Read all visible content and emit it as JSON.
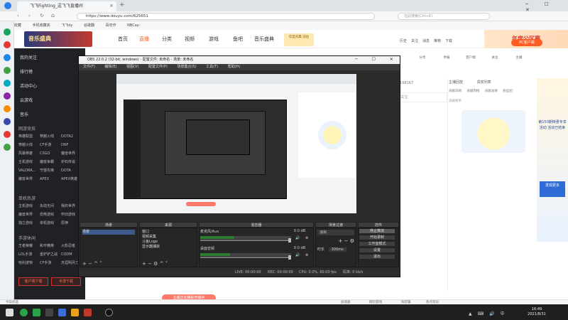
{
  "browser": {
    "tab_title": "飞飞Fighting_逗飞飞直播间",
    "url": "https://www.douyu.com/625651",
    "search_placeholder": "在此搜索(Ctrl+E)",
    "bookmarks": [
      "收藏",
      "手机收藏夹",
      "飞飞dy",
      "谷歌翻",
      "百年作",
      "NBCay-"
    ]
  },
  "douyu": {
    "logo": "音乐盛典",
    "nav": {
      "home": "首页",
      "live": "直播",
      "category": "分类",
      "video": "视频",
      "game": "游戏",
      "fishbar": "鱼吧",
      "music": "音乐盛典"
    },
    "promo": "年度庆典 前往",
    "header_icons": [
      "历史",
      "关注",
      "消息",
      "推荐",
      "下载"
    ],
    "banner_right": "年度公区赛",
    "pc_client": "PC客户端",
    "big_icons": [
      "分享",
      "举报",
      "客户端",
      "关注",
      "主播"
    ],
    "sidebar": {
      "my_follow": "我的关注",
      "ranking": "排行榜",
      "events": "活动中心",
      "cloud_game": "云游戏",
      "music": "音乐",
      "section_online": "网游竞技",
      "online_games": [
        "英雄联盟",
        "穿越火线",
        "DOTA2",
        "穿越火线",
        "CF手游",
        "DNF",
        "风暴英雄",
        "CSGO",
        "魔兽世界",
        "主机游戏",
        "魔兽争霸",
        "炉石传说",
        "VALORA...",
        "守望先锋",
        "DOTA",
        "魔兽世界",
        "APEX",
        "APEX英雄"
      ],
      "section_single": "单机热游",
      "single_games": [
        "主机游戏",
        "永劫无间",
        "我的世界",
        "魔兽世界",
        "恐怖游戏",
        "怀旧游戏",
        "独立游戏",
        "单机游戏",
        "原神"
      ],
      "section_mobile": "手游休闲",
      "mobile_games": [
        "王者荣耀",
        "和平精英",
        "火影忍者",
        "LOL手游",
        "金铲铲之战",
        "CODM",
        "哈利波特",
        "CF手游",
        "天涯明月刀"
      ],
      "download_btn": "客户端下载",
      "download_btn2": "手游下载"
    },
    "right_panel": {
      "tabs": [
        "主播回放",
        "贵宾列表"
      ],
      "sub_tabs": [
        "贡献日榜",
        "贡献周榜",
        "贡献总榜",
        "粉丝团"
      ],
      "hint": "贡献榜单",
      "floor": "2168167",
      "follow": "关注",
      "ad_text": "第150期特惠专享活动 活动已结束",
      "ad_blue": "发现更多"
    },
    "pill": "主播正在精彩开播中"
  },
  "obs": {
    "title": "OBS 22.0.2 (32-bit, windows) - 配置文件: 未命名 - 场景: 未命名",
    "menu": [
      "文件(F)",
      "编辑(E)",
      "视图(V)",
      "配置文件(P)",
      "场景集合(S)",
      "工具(T)",
      "帮助(H)"
    ],
    "docks": {
      "scenes": "场景",
      "sources": "来源",
      "mixer": "混音器",
      "transitions": "场景过渡",
      "controls": "控件"
    },
    "scene_list": [
      "场景"
    ],
    "source_list": [
      "窗口",
      "视频采集",
      "斗鱼Logo",
      "显示器捕获"
    ],
    "mixer_tracks": [
      {
        "name": "麦克风/Aux",
        "db": "0.0 dB",
        "level": 0.62
      },
      {
        "name": "桌面音频",
        "db": "0.0 dB",
        "level": 0.55
      }
    ],
    "transition_type": "淡出",
    "duration_label": "时长",
    "duration_value": "300ms",
    "control_buttons": [
      "停止推流",
      "开始录制",
      "工作室模式",
      "设置",
      "退出"
    ],
    "status": {
      "live": "LIVE: 00:00:00",
      "rec": "REC: 00:00:00",
      "cpu": "CPU: 0.0%, 60.00 fps",
      "kbps": "码率: 0 kb/s"
    }
  },
  "bottom_status": {
    "left": "今日优选",
    "middle": [
      "加速器",
      "网页游戏",
      "快剪辑"
    ],
    "right": [
      "热点资讯"
    ]
  },
  "taskbar": {
    "clock_time": "16:49",
    "clock_date": "2021/8/31"
  }
}
